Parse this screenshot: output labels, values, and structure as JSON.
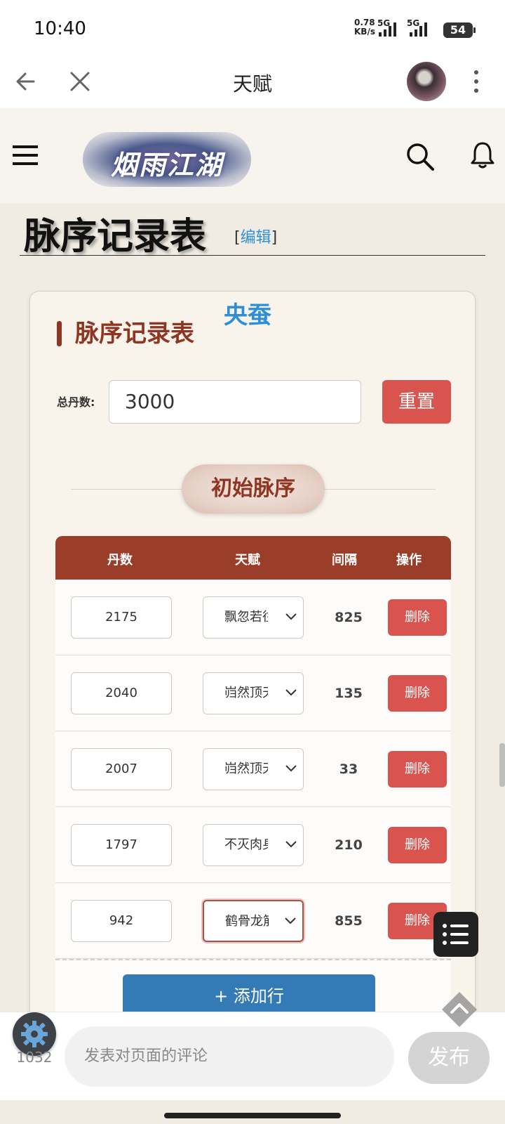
{
  "status_bar": {
    "time": "10:40",
    "net_speed_value": "0.78",
    "net_speed_unit": "KB/s",
    "sim1": "5G",
    "sim2": "5G",
    "battery": "54"
  },
  "app_bar": {
    "title": "天赋"
  },
  "site_header": {
    "logo_text": "烟雨江湖"
  },
  "page": {
    "heading": "脉序记录表",
    "edit_open": "[",
    "edit_label": "编辑",
    "edit_close": "]"
  },
  "card": {
    "character": "央蚕",
    "title": "脉序记录表",
    "total_label": "总丹数:",
    "total_value": "3000",
    "reset_label": "重置",
    "section_label": "初始脉序",
    "table": {
      "headers": [
        "丹数",
        "天赋",
        "间隔",
        "操作"
      ],
      "rows": [
        {
          "dan": "2175",
          "talent": "飘忽若往",
          "gap": "825",
          "action": "删除"
        },
        {
          "dan": "2040",
          "talent": "岿然顶天",
          "gap": "135",
          "action": "删除"
        },
        {
          "dan": "2007",
          "talent": "岿然顶天",
          "gap": "33",
          "action": "删除"
        },
        {
          "dan": "1797",
          "talent": "不灭肉身",
          "gap": "210",
          "action": "删除"
        },
        {
          "dan": "942",
          "talent": "鹤骨龙筋",
          "gap": "855",
          "action": "删除"
        }
      ]
    },
    "add_row_label": "+ 添加行"
  },
  "comment_bar": {
    "count": "1032",
    "placeholder": "发表对页面的评论",
    "post_label": "发布"
  },
  "colors": {
    "accent_red": "#d9534f",
    "header_brown": "#9a3e2a",
    "title_brown": "#8f3522",
    "link_blue": "#2f8fd6",
    "button_blue": "#337ab7"
  },
  "icons": [
    "back-arrow-icon",
    "close-icon",
    "more-vertical-icon",
    "hamburger-menu-icon",
    "search-icon",
    "bell-icon",
    "chevron-down-icon",
    "list-icon",
    "chevron-up-icon",
    "gear-icon"
  ]
}
